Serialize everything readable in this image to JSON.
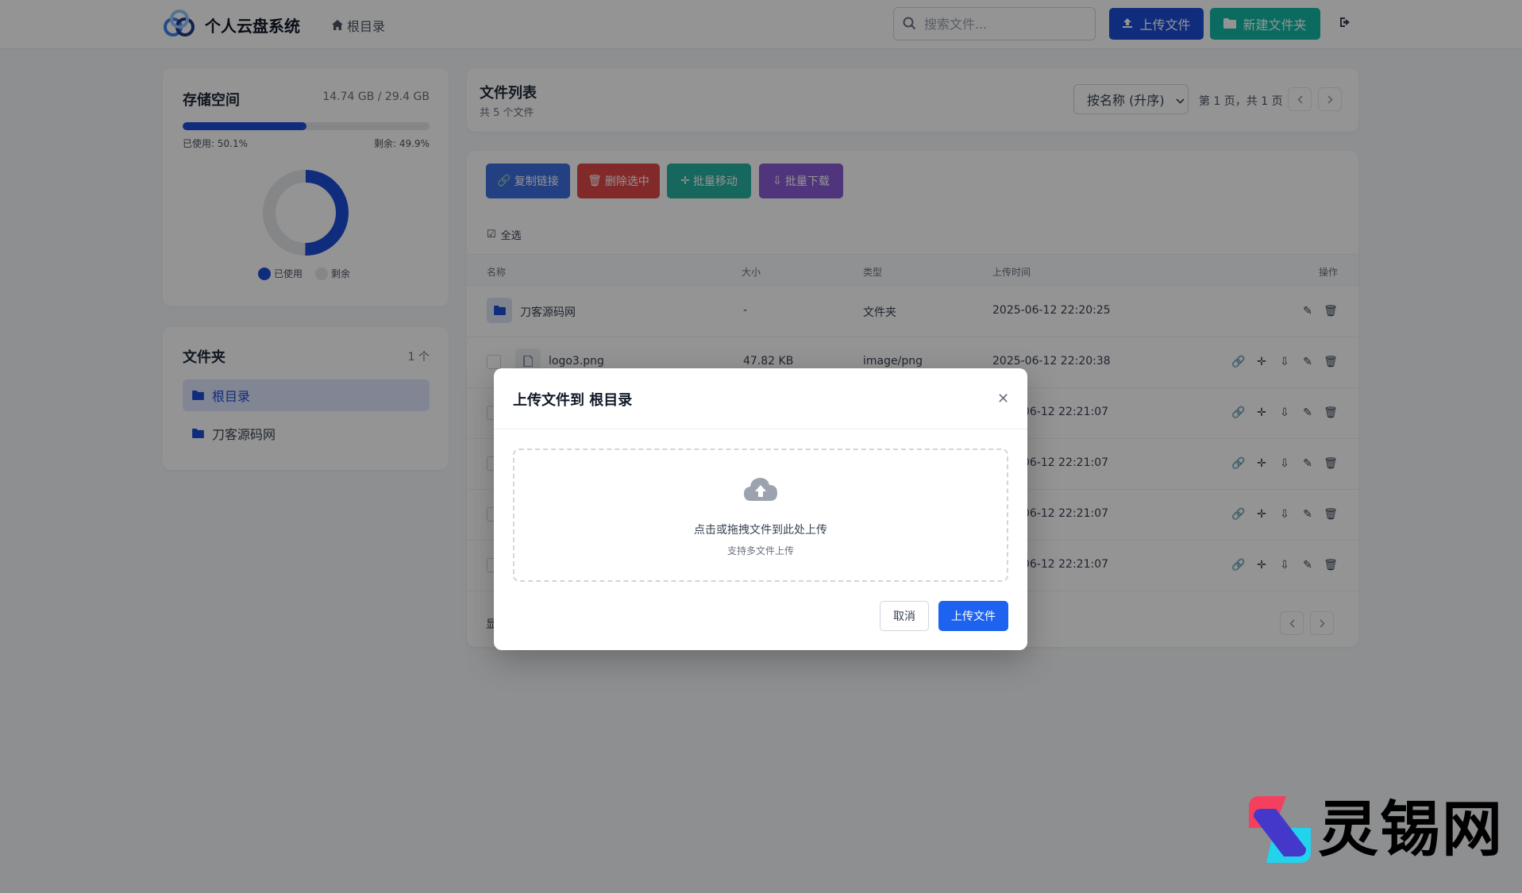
{
  "header": {
    "app_title": "个人云盘系统",
    "breadcrumb": "根目录",
    "search_placeholder": "搜索文件...",
    "upload_label": "上传文件",
    "new_folder_label": "新建文件夹"
  },
  "storage": {
    "title": "存储空间",
    "usage": "14.74 GB / 29.4 GB",
    "used_label": "已使用: 50.1%",
    "remaining_label": "剩余: 49.9%",
    "used_fraction": 0.501,
    "legend_used": "已使用",
    "legend_remaining": "剩余",
    "colors": {
      "used": "#1d4ed8",
      "remaining": "#e5e7eb"
    }
  },
  "folders": {
    "title": "文件夹",
    "count": "1 个",
    "items": [
      {
        "label": "根目录"
      },
      {
        "label": "刀客源码网"
      }
    ]
  },
  "file_list": {
    "title": "文件列表",
    "subtitle": "共 5 个文件",
    "sort_selected": "按名称 (升序)",
    "page_info": "第 1 页，共 1 页",
    "actions": {
      "copy_link": "复制链接",
      "delete_selected": "删除选中",
      "batch_move": "批量移动",
      "batch_download": "批量下载"
    },
    "select_all": "全选",
    "columns": {
      "name": "名称",
      "size": "大小",
      "type": "类型",
      "uploaded": "上传时间",
      "ops": "操作"
    },
    "rows": [
      {
        "name": "刀客源码网",
        "size": "-",
        "type": "文件夹",
        "time": "2025-06-12 22:20:25"
      },
      {
        "name": "logo3.png",
        "size": "47.82 KB",
        "type": "image/png",
        "time": "2025-06-12 22:20:38"
      },
      {
        "time_partial": "06-12 22:21:07"
      },
      {
        "time_partial": "06-12 22:21:07"
      },
      {
        "time_partial": "06-12 22:21:07"
      },
      {
        "time_partial": "06-12 22:21:07"
      }
    ],
    "footer_char": "显"
  },
  "modal": {
    "title": "上传文件到 根目录",
    "drop_text": "点击或拖拽文件到此处上传",
    "drop_sub": "支持多文件上传",
    "cancel_label": "取消",
    "upload_label": "上传文件"
  },
  "watermark": {
    "text": "灵锡网"
  }
}
